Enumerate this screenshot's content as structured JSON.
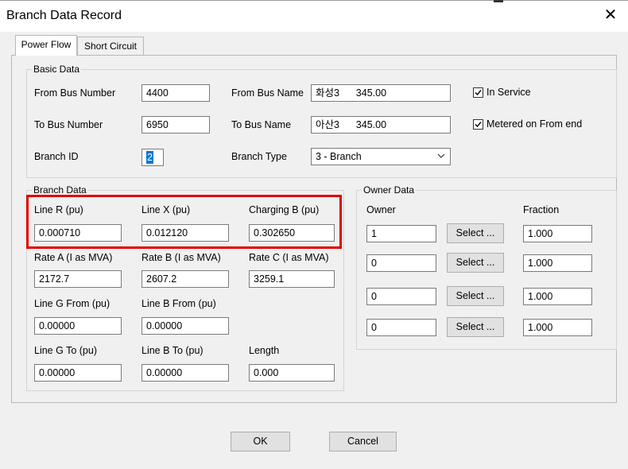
{
  "window": {
    "title": "Branch Data Record"
  },
  "tabs": [
    {
      "label": "Power Flow",
      "active": true
    },
    {
      "label": "Short Circuit",
      "active": false
    }
  ],
  "basic_data": {
    "legend": "Basic Data",
    "from_bus_number": {
      "label": "From Bus Number",
      "value": "4400"
    },
    "to_bus_number": {
      "label": "To Bus Number",
      "value": "6950"
    },
    "branch_id": {
      "label": "Branch ID",
      "value": "2"
    },
    "from_bus_name": {
      "label": "From Bus Name",
      "value": "화성3      345.00"
    },
    "to_bus_name": {
      "label": "To Bus Name",
      "value": "아산3      345.00"
    },
    "branch_type": {
      "label": "Branch Type",
      "value": "3 - Branch"
    },
    "in_service": {
      "label": "In Service",
      "checked": true
    },
    "metered": {
      "label": "Metered on From end",
      "checked": true
    }
  },
  "branch_data": {
    "legend": "Branch Data",
    "line_r": {
      "label": "Line R (pu)",
      "value": "0.000710"
    },
    "line_x": {
      "label": "Line X (pu)",
      "value": "0.012120"
    },
    "charging_b": {
      "label": "Charging B (pu)",
      "value": "0.302650"
    },
    "rate_a": {
      "label": "Rate A (I as MVA)",
      "value": "2172.7"
    },
    "rate_b": {
      "label": "Rate B (I as MVA)",
      "value": "2607.2"
    },
    "rate_c": {
      "label": "Rate C (I as MVA)",
      "value": "3259.1"
    },
    "line_g_from": {
      "label": "Line G From (pu)",
      "value": "0.00000"
    },
    "line_b_from": {
      "label": "Line B From (pu)",
      "value": "0.00000"
    },
    "line_g_to": {
      "label": "Line G To (pu)",
      "value": "0.00000"
    },
    "line_b_to": {
      "label": "Line B To (pu)",
      "value": "0.00000"
    },
    "length": {
      "label": "Length",
      "value": "0.000"
    }
  },
  "owner_data": {
    "legend": "Owner Data",
    "owner_header": "Owner",
    "fraction_header": "Fraction",
    "select_label": "Select ...",
    "rows": [
      {
        "owner": "1",
        "fraction": "1.000"
      },
      {
        "owner": "0",
        "fraction": "1.000"
      },
      {
        "owner": "0",
        "fraction": "1.000"
      },
      {
        "owner": "0",
        "fraction": "1.000"
      }
    ]
  },
  "buttons": {
    "ok": "OK",
    "cancel": "Cancel"
  },
  "colors": {
    "highlight": "#e00000",
    "dialog_bg": "#f0f0f0",
    "selection": "#0078d7"
  }
}
